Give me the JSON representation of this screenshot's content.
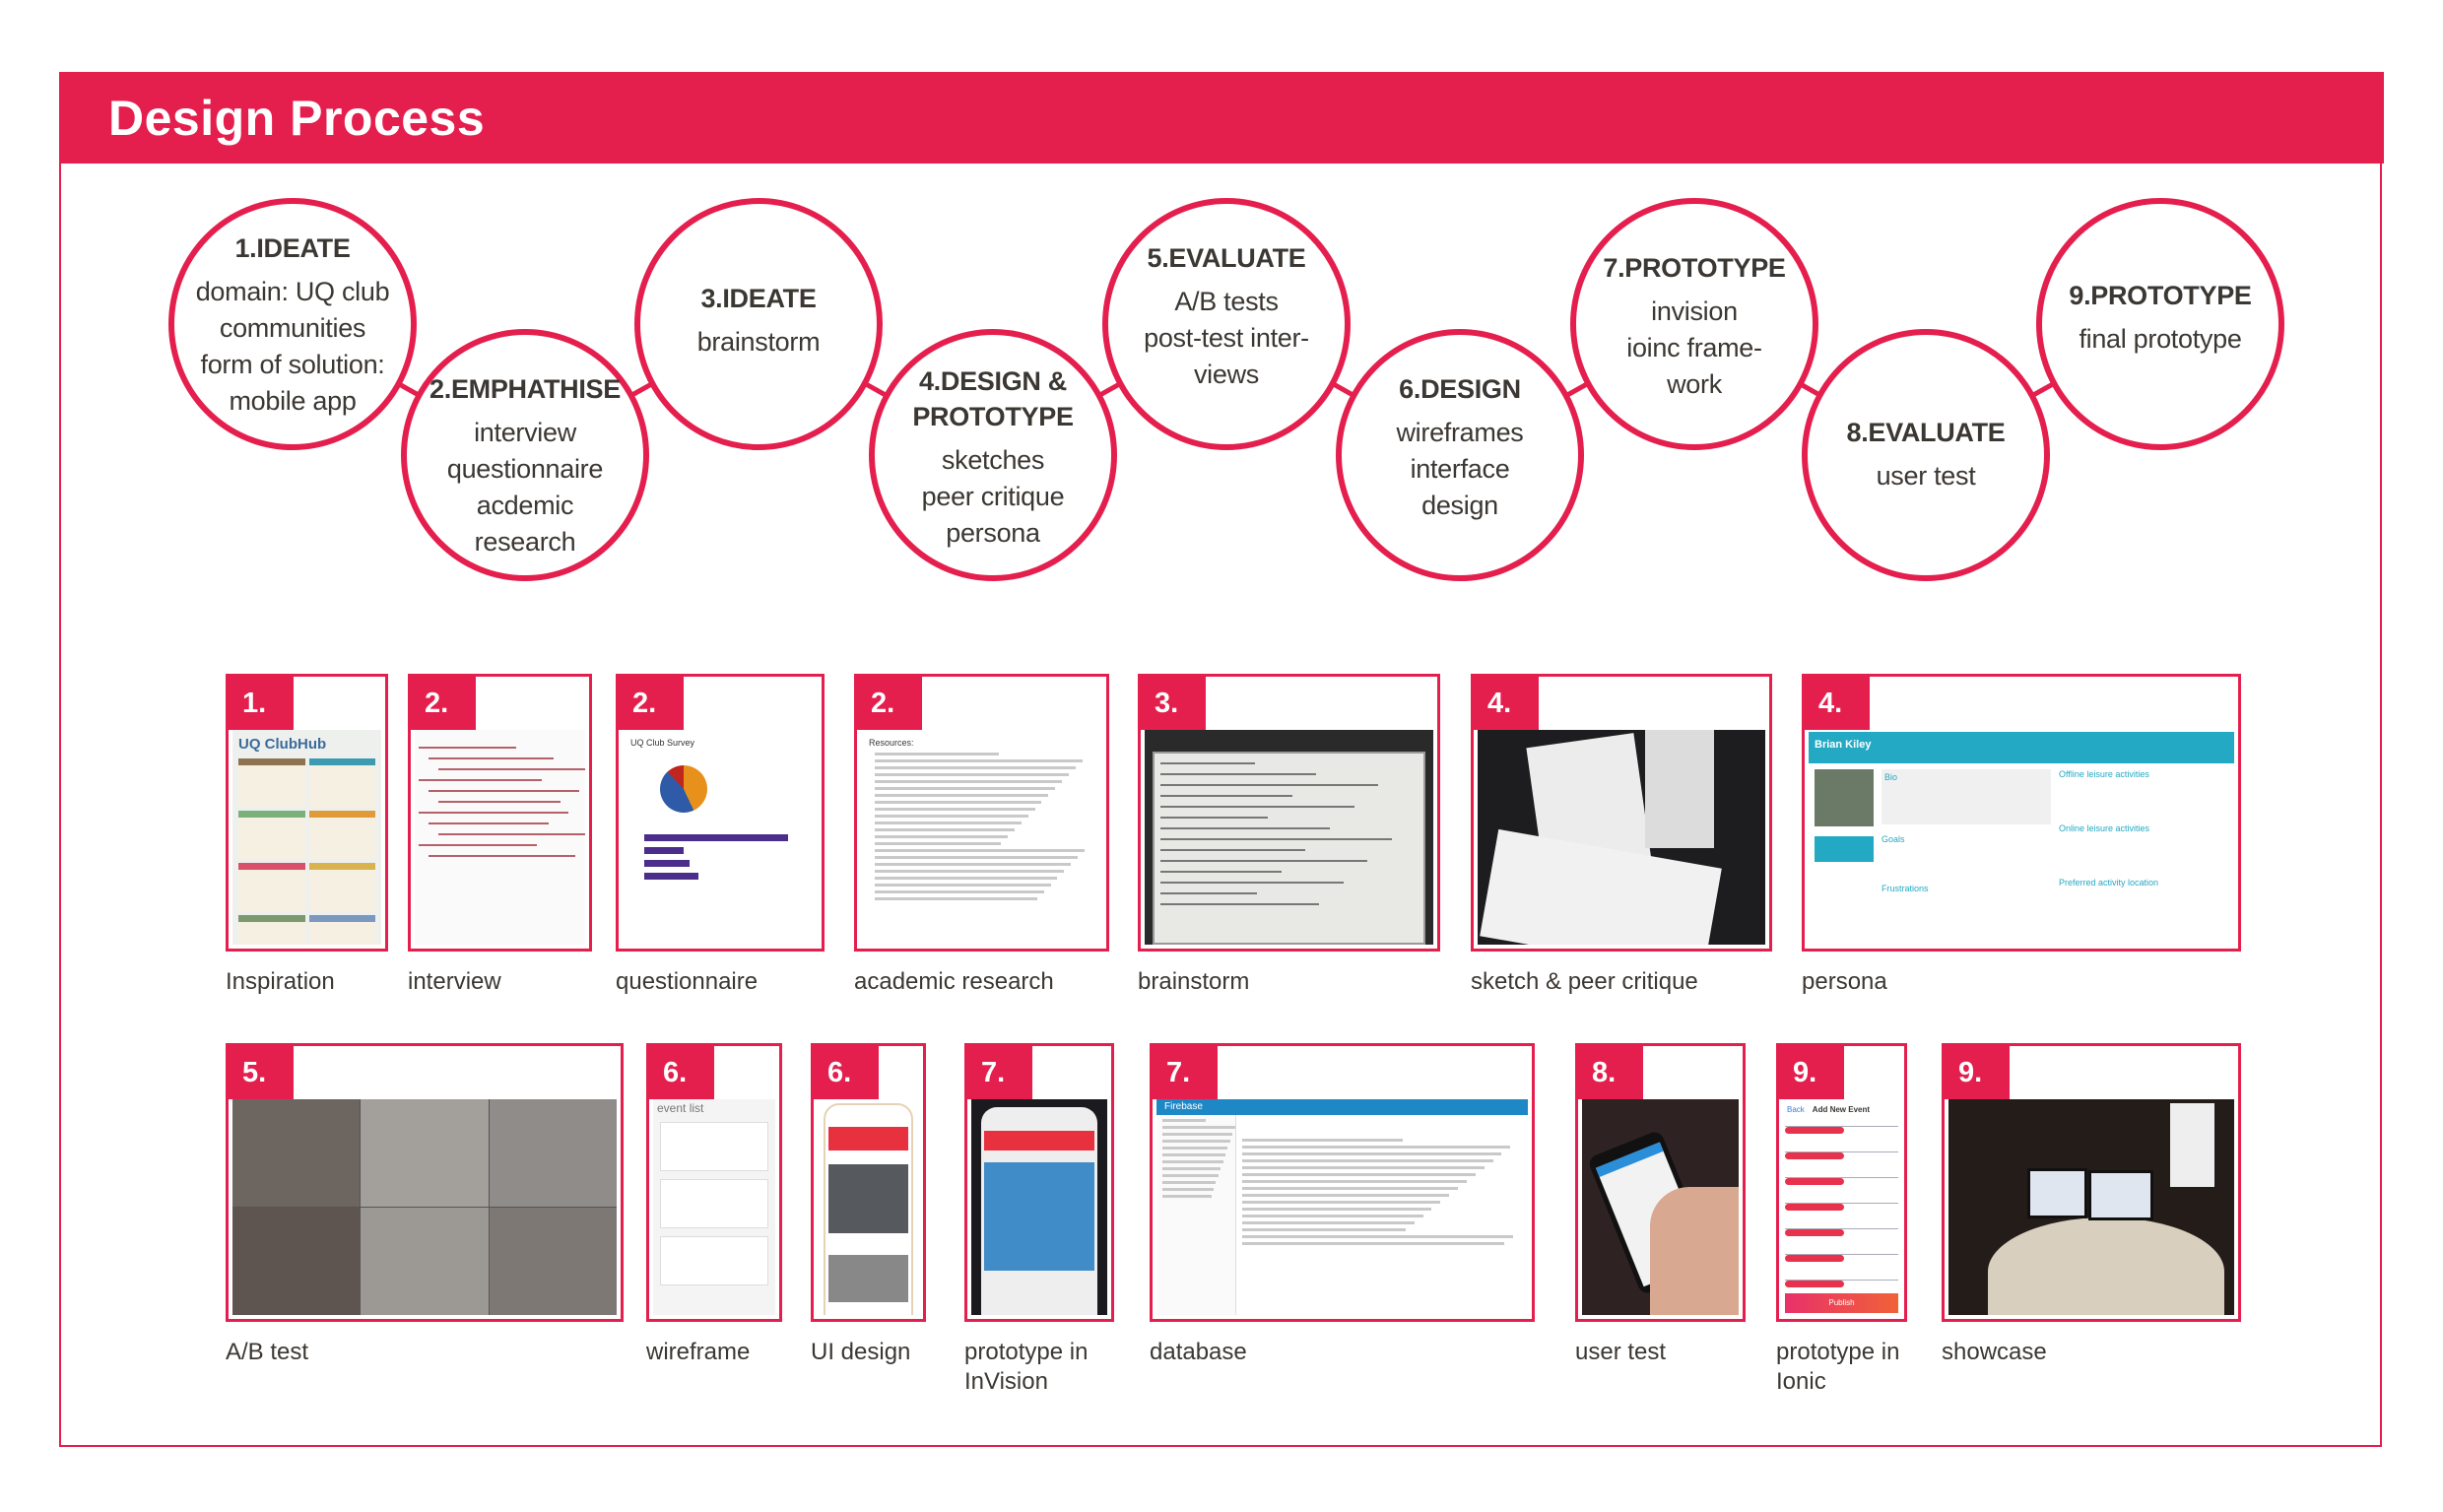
{
  "header": {
    "title": "Design Process"
  },
  "colors": {
    "accent": "#e41f4d",
    "text": "#3b3733",
    "persona_teal": "#23a9c4",
    "firebase_blue": "#1e88c7"
  },
  "process_steps": [
    {
      "title": "1.IDEATE",
      "lines": [
        "domain: UQ club",
        "communities",
        "form of solution:",
        "mobile app"
      ]
    },
    {
      "title": "2.EMPHATHISE",
      "lines": [
        "interview",
        "questionnaire",
        "acdemic",
        "research"
      ]
    },
    {
      "title": "3.IDEATE",
      "lines": [
        "brainstorm"
      ]
    },
    {
      "title": "4.DESIGN & PROTOTYPE",
      "lines": [
        "sketches",
        "peer critique",
        "persona"
      ]
    },
    {
      "title": "5.EVALUATE",
      "lines": [
        "A/B tests",
        "post-test inter-",
        "views"
      ]
    },
    {
      "title": "6.DESIGN",
      "lines": [
        "wireframes",
        "interface",
        "design"
      ]
    },
    {
      "title": "7.PROTOTYPE",
      "lines": [
        "invision",
        "ioinc frame-",
        "work"
      ]
    },
    {
      "title": "8.EVALUATE",
      "lines": [
        "user test"
      ]
    },
    {
      "title": "9.PROTOTYPE",
      "lines": [
        "final prototype"
      ]
    }
  ],
  "thumbnails": [
    {
      "number": "1.",
      "label": "Inspiration",
      "kind": "poster",
      "content": {
        "heading": "UQ ClubHub"
      }
    },
    {
      "number": "2.",
      "label": "interview",
      "kind": "handwriting",
      "content": {}
    },
    {
      "number": "2.",
      "label": "questionnaire",
      "kind": "survey",
      "content": {
        "heading": "UQ Club Survey"
      }
    },
    {
      "number": "2.",
      "label": "academic research",
      "kind": "document",
      "content": {
        "heading": "Resources:"
      }
    },
    {
      "number": "3.",
      "label": "brainstorm",
      "kind": "whiteboard",
      "content": {}
    },
    {
      "number": "4.",
      "label": "sketch & peer critique",
      "kind": "sketch",
      "content": {}
    },
    {
      "number": "4.",
      "label": "persona",
      "kind": "persona",
      "content": {
        "name": "Brian Kiley",
        "bio": "Bio",
        "goals": "Goals",
        "frustrations": "Frustrations",
        "offline": "Offline leisure activities",
        "online": "Online leisure activities",
        "location": "Preferred activity location"
      }
    },
    {
      "number": "5.",
      "label": "A/B test",
      "kind": "abtest",
      "content": {}
    },
    {
      "number": "6.",
      "label": "wireframe",
      "kind": "wireframe",
      "content": {
        "heading": "event list"
      }
    },
    {
      "number": "6.",
      "label": "UI design",
      "kind": "phone",
      "content": {}
    },
    {
      "number": "7.",
      "label": "prototype in InVision",
      "kind": "invision",
      "content": {}
    },
    {
      "number": "7.",
      "label": "database",
      "kind": "firebase",
      "content": {
        "heading": "Firebase"
      }
    },
    {
      "number": "8.",
      "label": "user test",
      "kind": "usertest",
      "content": {}
    },
    {
      "number": "9.",
      "label": "prototype in Ionic",
      "kind": "ionic",
      "content": {
        "back": "Back",
        "heading": "Add New Event",
        "publish": "Publish"
      }
    },
    {
      "number": "9.",
      "label": "showcase",
      "kind": "showcase",
      "content": {}
    }
  ]
}
